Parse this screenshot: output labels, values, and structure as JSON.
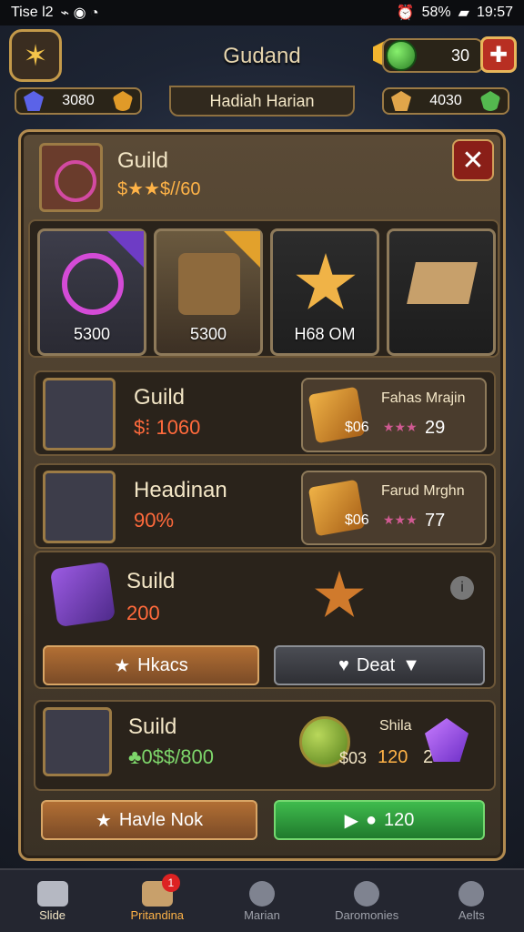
{
  "status": {
    "left": "Tise l2",
    "signal": "58%",
    "time": "19:57"
  },
  "header": {
    "title": "Gudand",
    "currency_value": "30"
  },
  "subbar": {
    "left_value": "3080",
    "center_label": "Hadiah Harian",
    "right_value": "4030"
  },
  "guild": {
    "title": "Guild",
    "subtitle": "$★★$//60"
  },
  "shop_items": [
    {
      "price": "5300",
      "ribbon": "purple",
      "art": "orb"
    },
    {
      "price": "5300",
      "ribbon": "gold",
      "art": "chest"
    },
    {
      "price": "H68 OM",
      "art": "star-bell"
    },
    {
      "price": "",
      "art": "box"
    }
  ],
  "rows": [
    {
      "title": "Guild",
      "value": "$⁞ 1060",
      "mini_name": "Fahas Mrajin",
      "mini_stat": "$06",
      "mini_count": "29"
    },
    {
      "title": "Headinan",
      "value": "90%",
      "mini_name": "Farud Mrghn",
      "mini_stat": "$06",
      "mini_count": "77"
    }
  ],
  "suild_box": {
    "title": "Suild",
    "value": "200",
    "button_left": "Hkacs",
    "button_right": "Deat"
  },
  "suild_row": {
    "title": "Suild",
    "value": "♣0$$/800",
    "label": "Shila",
    "stat": "$03",
    "count": "120",
    "extra": "2"
  },
  "bottom_buttons": {
    "left": "Havle Nok",
    "right": "120"
  },
  "nav": [
    {
      "label": "Slide",
      "icon": "home-icon"
    },
    {
      "label": "Pritandina",
      "icon": "document-icon",
      "badge": "1"
    },
    {
      "label": "Marian",
      "icon": "search-icon"
    },
    {
      "label": "Daromonies",
      "icon": "search-icon"
    },
    {
      "label": "Aelts",
      "icon": "gear-icon"
    }
  ]
}
